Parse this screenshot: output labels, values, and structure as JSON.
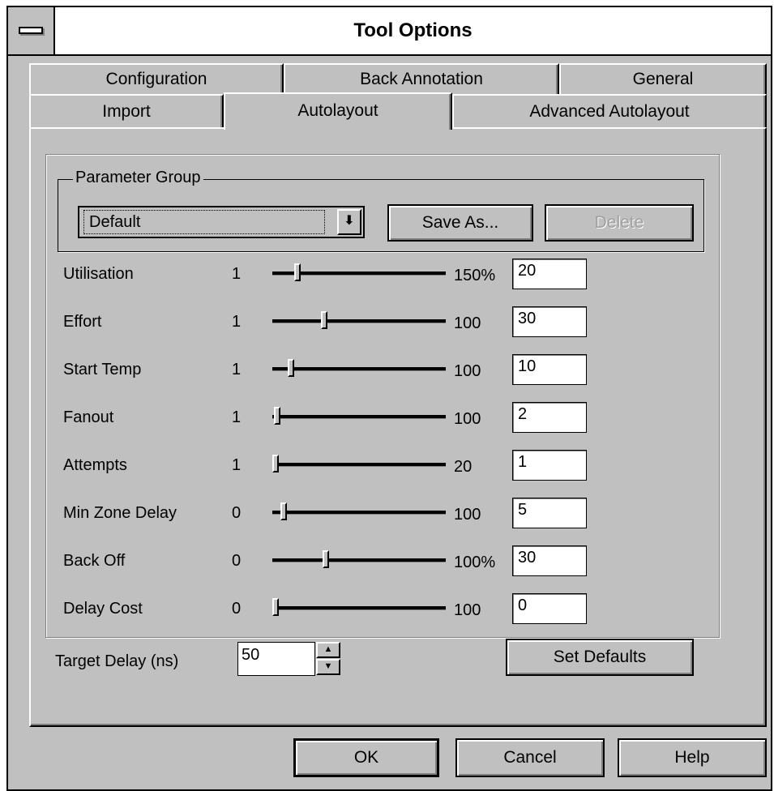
{
  "window": {
    "title": "Tool Options"
  },
  "tabs": {
    "row1": [
      "Configuration",
      "Back Annotation",
      "General"
    ],
    "row2": [
      "Import",
      "Autolayout",
      "Advanced Autolayout"
    ],
    "active": "Autolayout"
  },
  "parameter_group": {
    "label": "Parameter Group",
    "selected": "Default",
    "save_as": "Save As...",
    "delete": "Delete"
  },
  "sliders": [
    {
      "label": "Utilisation",
      "min": "1",
      "max": "150%",
      "value": "20",
      "level": 0.13
    },
    {
      "label": "Effort",
      "min": "1",
      "max": "100",
      "value": "30",
      "level": 0.29
    },
    {
      "label": "Start Temp",
      "min": "1",
      "max": "100",
      "value": "10",
      "level": 0.09
    },
    {
      "label": "Fanout",
      "min": "1",
      "max": "100",
      "value": "2",
      "level": 0.01
    },
    {
      "label": "Attempts",
      "min": "1",
      "max": "20",
      "value": "1",
      "level": 0.0
    },
    {
      "label": "Min Zone Delay",
      "min": "0",
      "max": "100",
      "value": "5",
      "level": 0.05
    },
    {
      "label": "Back Off",
      "min": "0",
      "max": "100%",
      "value": "30",
      "level": 0.3
    },
    {
      "label": "Delay Cost",
      "min": "0",
      "max": "100",
      "value": "0",
      "level": 0.0
    }
  ],
  "target_delay": {
    "label": "Target Delay (ns)",
    "value": "50"
  },
  "set_defaults": "Set Defaults",
  "footer": {
    "ok": "OK",
    "cancel": "Cancel",
    "help": "Help"
  }
}
